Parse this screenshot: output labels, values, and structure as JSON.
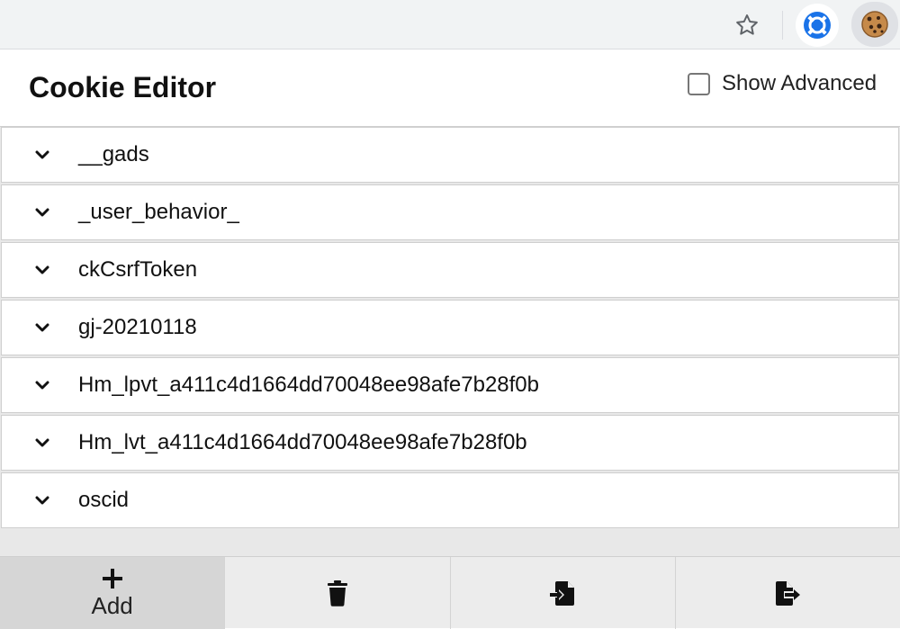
{
  "popup": {
    "title": "Cookie Editor",
    "show_advanced_label": "Show Advanced",
    "show_advanced_checked": false
  },
  "cookies": [
    {
      "name": "__gads"
    },
    {
      "name": "_user_behavior_"
    },
    {
      "name": "ckCsrfToken"
    },
    {
      "name": "gj-20210118"
    },
    {
      "name": "Hm_lpvt_a411c4d1664dd70048ee98afe7b28f0b"
    },
    {
      "name": "Hm_lvt_a411c4d1664dd70048ee98afe7b28f0b"
    },
    {
      "name": "oscid"
    }
  ],
  "actions": {
    "add_label": "Add",
    "add_icon": "plus-icon",
    "delete_icon": "trash-icon",
    "import_icon": "file-import-icon",
    "export_icon": "file-export-icon"
  },
  "toolbar": {
    "star_icon": "star-icon",
    "sync_extension_icon": "sync-icon",
    "cookie_extension_icon": "cookie-icon"
  },
  "colors": {
    "accent_blue": "#1a73e8",
    "cookie_brown": "#c68a4a"
  }
}
